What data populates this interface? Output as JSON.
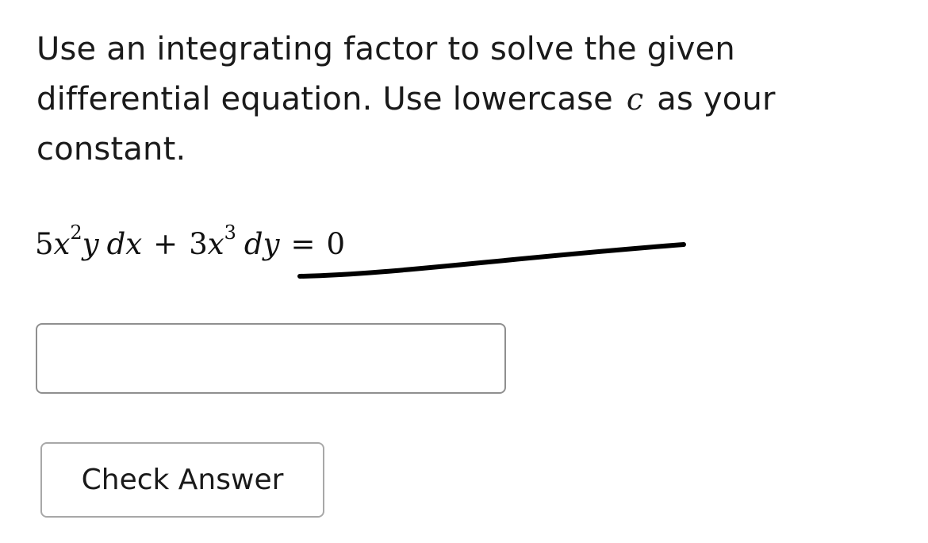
{
  "question": {
    "part1": "Use an integrating factor to solve the given differential equation. Use lowercase",
    "variable": "c",
    "part2": "as your constant."
  },
  "equation": {
    "coef1": "5",
    "x1": "x",
    "exp1": "2",
    "y1": "y",
    "dx": "dx",
    "plus": "+",
    "coef2": "3",
    "x2": "x",
    "exp2": "3",
    "dy": "dy",
    "equals": "=",
    "rhs": "0"
  },
  "answer": {
    "value": "",
    "placeholder": ""
  },
  "check_button": {
    "label": "Check Answer"
  },
  "colors": {
    "text": "#1a1a1a",
    "input_border": "#8f8f8f",
    "button_border": "#a8a8a8",
    "scribble": "#000000"
  }
}
